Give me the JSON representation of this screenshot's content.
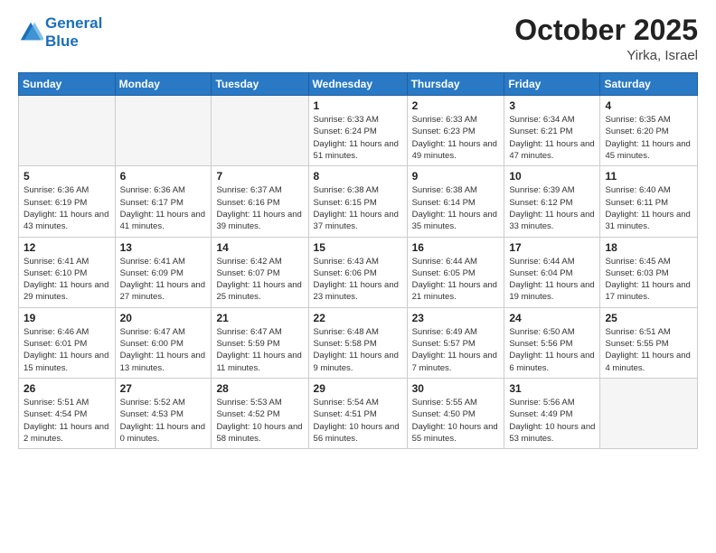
{
  "header": {
    "logo_line1": "General",
    "logo_line2": "Blue",
    "month_title": "October 2025",
    "location": "Yirka, Israel"
  },
  "weekdays": [
    "Sunday",
    "Monday",
    "Tuesday",
    "Wednesday",
    "Thursday",
    "Friday",
    "Saturday"
  ],
  "weeks": [
    [
      {
        "day": "",
        "sunrise": "",
        "sunset": "",
        "daylight": ""
      },
      {
        "day": "",
        "sunrise": "",
        "sunset": "",
        "daylight": ""
      },
      {
        "day": "",
        "sunrise": "",
        "sunset": "",
        "daylight": ""
      },
      {
        "day": "1",
        "sunrise": "Sunrise: 6:33 AM",
        "sunset": "Sunset: 6:24 PM",
        "daylight": "Daylight: 11 hours and 51 minutes."
      },
      {
        "day": "2",
        "sunrise": "Sunrise: 6:33 AM",
        "sunset": "Sunset: 6:23 PM",
        "daylight": "Daylight: 11 hours and 49 minutes."
      },
      {
        "day": "3",
        "sunrise": "Sunrise: 6:34 AM",
        "sunset": "Sunset: 6:21 PM",
        "daylight": "Daylight: 11 hours and 47 minutes."
      },
      {
        "day": "4",
        "sunrise": "Sunrise: 6:35 AM",
        "sunset": "Sunset: 6:20 PM",
        "daylight": "Daylight: 11 hours and 45 minutes."
      }
    ],
    [
      {
        "day": "5",
        "sunrise": "Sunrise: 6:36 AM",
        "sunset": "Sunset: 6:19 PM",
        "daylight": "Daylight: 11 hours and 43 minutes."
      },
      {
        "day": "6",
        "sunrise": "Sunrise: 6:36 AM",
        "sunset": "Sunset: 6:17 PM",
        "daylight": "Daylight: 11 hours and 41 minutes."
      },
      {
        "day": "7",
        "sunrise": "Sunrise: 6:37 AM",
        "sunset": "Sunset: 6:16 PM",
        "daylight": "Daylight: 11 hours and 39 minutes."
      },
      {
        "day": "8",
        "sunrise": "Sunrise: 6:38 AM",
        "sunset": "Sunset: 6:15 PM",
        "daylight": "Daylight: 11 hours and 37 minutes."
      },
      {
        "day": "9",
        "sunrise": "Sunrise: 6:38 AM",
        "sunset": "Sunset: 6:14 PM",
        "daylight": "Daylight: 11 hours and 35 minutes."
      },
      {
        "day": "10",
        "sunrise": "Sunrise: 6:39 AM",
        "sunset": "Sunset: 6:12 PM",
        "daylight": "Daylight: 11 hours and 33 minutes."
      },
      {
        "day": "11",
        "sunrise": "Sunrise: 6:40 AM",
        "sunset": "Sunset: 6:11 PM",
        "daylight": "Daylight: 11 hours and 31 minutes."
      }
    ],
    [
      {
        "day": "12",
        "sunrise": "Sunrise: 6:41 AM",
        "sunset": "Sunset: 6:10 PM",
        "daylight": "Daylight: 11 hours and 29 minutes."
      },
      {
        "day": "13",
        "sunrise": "Sunrise: 6:41 AM",
        "sunset": "Sunset: 6:09 PM",
        "daylight": "Daylight: 11 hours and 27 minutes."
      },
      {
        "day": "14",
        "sunrise": "Sunrise: 6:42 AM",
        "sunset": "Sunset: 6:07 PM",
        "daylight": "Daylight: 11 hours and 25 minutes."
      },
      {
        "day": "15",
        "sunrise": "Sunrise: 6:43 AM",
        "sunset": "Sunset: 6:06 PM",
        "daylight": "Daylight: 11 hours and 23 minutes."
      },
      {
        "day": "16",
        "sunrise": "Sunrise: 6:44 AM",
        "sunset": "Sunset: 6:05 PM",
        "daylight": "Daylight: 11 hours and 21 minutes."
      },
      {
        "day": "17",
        "sunrise": "Sunrise: 6:44 AM",
        "sunset": "Sunset: 6:04 PM",
        "daylight": "Daylight: 11 hours and 19 minutes."
      },
      {
        "day": "18",
        "sunrise": "Sunrise: 6:45 AM",
        "sunset": "Sunset: 6:03 PM",
        "daylight": "Daylight: 11 hours and 17 minutes."
      }
    ],
    [
      {
        "day": "19",
        "sunrise": "Sunrise: 6:46 AM",
        "sunset": "Sunset: 6:01 PM",
        "daylight": "Daylight: 11 hours and 15 minutes."
      },
      {
        "day": "20",
        "sunrise": "Sunrise: 6:47 AM",
        "sunset": "Sunset: 6:00 PM",
        "daylight": "Daylight: 11 hours and 13 minutes."
      },
      {
        "day": "21",
        "sunrise": "Sunrise: 6:47 AM",
        "sunset": "Sunset: 5:59 PM",
        "daylight": "Daylight: 11 hours and 11 minutes."
      },
      {
        "day": "22",
        "sunrise": "Sunrise: 6:48 AM",
        "sunset": "Sunset: 5:58 PM",
        "daylight": "Daylight: 11 hours and 9 minutes."
      },
      {
        "day": "23",
        "sunrise": "Sunrise: 6:49 AM",
        "sunset": "Sunset: 5:57 PM",
        "daylight": "Daylight: 11 hours and 7 minutes."
      },
      {
        "day": "24",
        "sunrise": "Sunrise: 6:50 AM",
        "sunset": "Sunset: 5:56 PM",
        "daylight": "Daylight: 11 hours and 6 minutes."
      },
      {
        "day": "25",
        "sunrise": "Sunrise: 6:51 AM",
        "sunset": "Sunset: 5:55 PM",
        "daylight": "Daylight: 11 hours and 4 minutes."
      }
    ],
    [
      {
        "day": "26",
        "sunrise": "Sunrise: 5:51 AM",
        "sunset": "Sunset: 4:54 PM",
        "daylight": "Daylight: 11 hours and 2 minutes."
      },
      {
        "day": "27",
        "sunrise": "Sunrise: 5:52 AM",
        "sunset": "Sunset: 4:53 PM",
        "daylight": "Daylight: 11 hours and 0 minutes."
      },
      {
        "day": "28",
        "sunrise": "Sunrise: 5:53 AM",
        "sunset": "Sunset: 4:52 PM",
        "daylight": "Daylight: 10 hours and 58 minutes."
      },
      {
        "day": "29",
        "sunrise": "Sunrise: 5:54 AM",
        "sunset": "Sunset: 4:51 PM",
        "daylight": "Daylight: 10 hours and 56 minutes."
      },
      {
        "day": "30",
        "sunrise": "Sunrise: 5:55 AM",
        "sunset": "Sunset: 4:50 PM",
        "daylight": "Daylight: 10 hours and 55 minutes."
      },
      {
        "day": "31",
        "sunrise": "Sunrise: 5:56 AM",
        "sunset": "Sunset: 4:49 PM",
        "daylight": "Daylight: 10 hours and 53 minutes."
      },
      {
        "day": "",
        "sunrise": "",
        "sunset": "",
        "daylight": ""
      }
    ]
  ]
}
